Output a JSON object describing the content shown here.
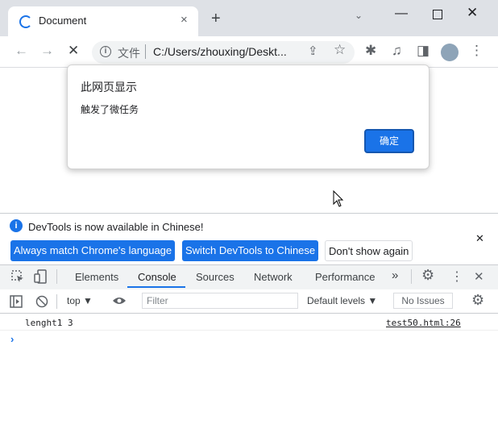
{
  "tab": {
    "title": "Document",
    "close": "×",
    "new_tab": "+"
  },
  "window": {
    "tab_search": "⌄",
    "minimize": "—",
    "close": "✕"
  },
  "toolbar": {
    "back": "←",
    "forward": "→",
    "stop": "✕",
    "omnibox_info": "i",
    "omnibox_scheme": "文件",
    "url": "C:/Users/zhouxing/Deskt...",
    "share": "⇪",
    "bookmark": "☆",
    "extensions": "✱",
    "media": "♫",
    "sidepanel": "◨",
    "menu": "⋮"
  },
  "dialog": {
    "title": "此网页显示",
    "message": "触发了微任务",
    "ok_label": "确定"
  },
  "infobar": {
    "icon": "i",
    "message": "DevTools is now available in Chinese!",
    "btn_match": "Always match Chrome's language",
    "btn_switch": "Switch DevTools to Chinese",
    "btn_dont": "Don't show again",
    "close": "✕"
  },
  "devtools": {
    "tabs": [
      "Elements",
      "Console",
      "Sources",
      "Network",
      "Performance"
    ],
    "more": "»",
    "settings": "⚙",
    "kebab": "⋮",
    "close": "✕"
  },
  "console_toolbar": {
    "top_context": "top",
    "filter_placeholder": "Filter",
    "levels": "Default levels",
    "issues": "No Issues"
  },
  "console": {
    "log_text": "lenght1 3",
    "log_source": "test50.html:26",
    "prompt": "›"
  },
  "colors": {
    "accent": "#1a73e8",
    "tabstrip": "#dee1e6"
  }
}
